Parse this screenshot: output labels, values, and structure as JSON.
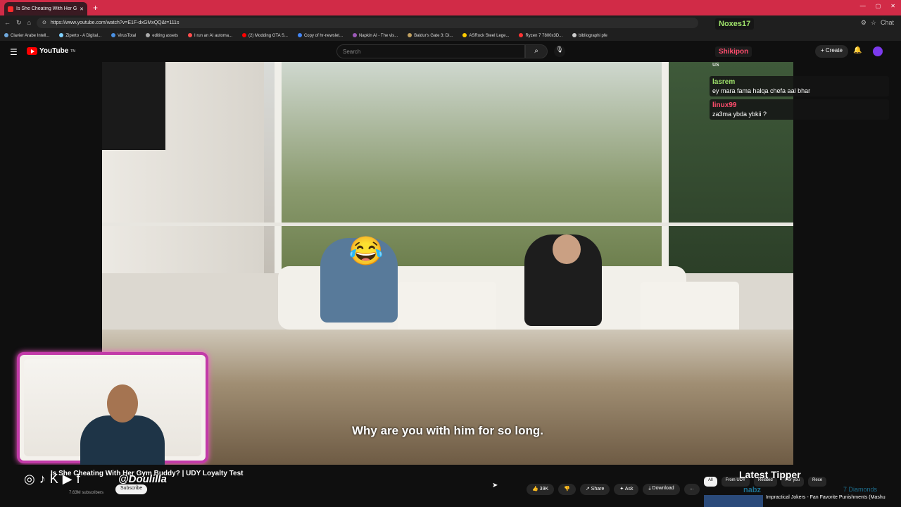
{
  "browser": {
    "tab_title": "Is She Cheating With Her Gym",
    "new_tab": "+",
    "url": "https://www.youtube.com/watch?v=E1F-dxGMxQQ&t=111s",
    "bookmarks": [
      "Clavier Arabe Intell...",
      "Ziperto - A Digital...",
      "VirusTotal",
      "editing assets",
      "I run an AI automa...",
      "(2) Modding GTA S...",
      "Copy of hr-newslet...",
      "Napkin AI - The vis...",
      "Baldur's Gate 3: Di...",
      "ASRock Steel Lege...",
      "Ryzen 7 7800x3D...",
      "bibliographi pfe"
    ],
    "chat_label": "Chat"
  },
  "youtube": {
    "logo": "YouTube",
    "logo_sup": "TN",
    "search_placeholder": "Search",
    "create_label": "Create"
  },
  "video": {
    "subtitle": "Why are you with him for so long.",
    "emoji": "😂"
  },
  "chat_overlay": {
    "top_user": "Noxes17",
    "second_user": "Shikipon",
    "first_text": "us",
    "messages": [
      {
        "user": "lasrem",
        "text": "ey mara fama halqa chefa aal bhar",
        "color": "#9fe36b"
      },
      {
        "user": "linux99",
        "text": "za3ma ybda ybkii ?",
        "color": "#ff4d6d"
      }
    ]
  },
  "below_video": {
    "title": "Is She Cheating With Her Gym Buddy? | UDY Loyalty Test",
    "handle": "@Doulilla",
    "subscribers": "7.63M subscribers",
    "subscribe": "Subscribe",
    "likes": "39K",
    "share": "Share",
    "ask": "Ask",
    "download": "Download",
    "more": "...",
    "latest_tipper": "Latest Tipper",
    "tipper_name": "nabz",
    "tipper_amount": "7 Diamonds",
    "chips": [
      "All",
      "From UDY",
      "Related",
      "For you",
      "Rece"
    ],
    "rec_title": "Impractical Jokers - Fan Favorite Punishments (Mashu"
  },
  "colors": {
    "accent": "#ff0000",
    "tab_bar": "#d12b47",
    "cam_border": "#c23aa8"
  }
}
